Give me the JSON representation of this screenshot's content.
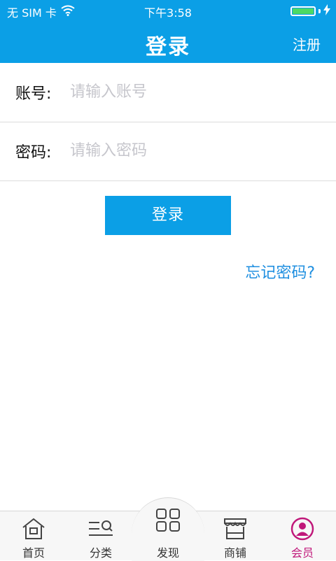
{
  "status_bar": {
    "carrier": "无 SIM 卡",
    "time": "下午3:58",
    "battery_color": "#4cd964"
  },
  "header": {
    "title": "登录",
    "register_label": "注册",
    "color": "#0b9fe6"
  },
  "form": {
    "account_label": "账号:",
    "account_placeholder": "请输入账号",
    "password_label": "密码:",
    "password_placeholder": "请输入密码"
  },
  "login_button_label": "登录",
  "forgot_password_label": "忘记密码?",
  "tabbar": {
    "active_color": "#c0187a",
    "tabs": [
      {
        "label": "首页",
        "icon": "home-icon"
      },
      {
        "label": "分类",
        "icon": "category-icon"
      },
      {
        "label": "发现",
        "icon": "grid-icon"
      },
      {
        "label": "商铺",
        "icon": "store-icon"
      },
      {
        "label": "会员",
        "icon": "user-icon",
        "active": true
      }
    ]
  }
}
